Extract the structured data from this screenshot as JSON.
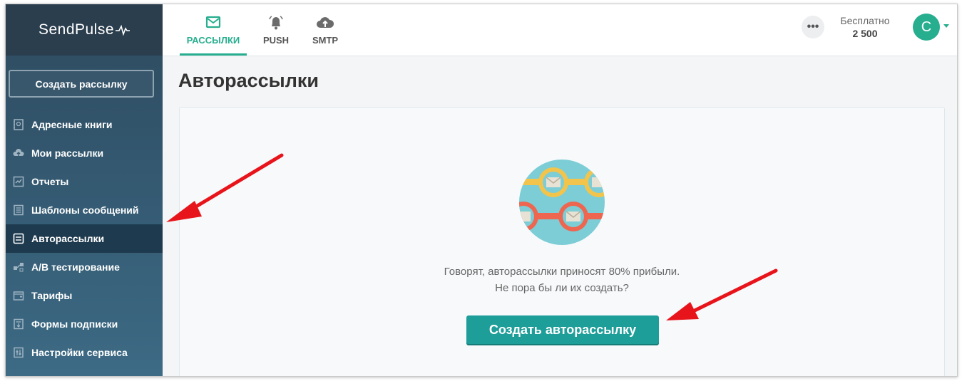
{
  "app": {
    "logo_text": "SendPulse"
  },
  "sidebar": {
    "create_button": "Создать рассылку",
    "items": [
      {
        "label": "Адресные книги",
        "icon": "address-book-icon"
      },
      {
        "label": "Мои рассылки",
        "icon": "upload-cloud-icon"
      },
      {
        "label": "Отчеты",
        "icon": "chart-icon"
      },
      {
        "label": "Шаблоны сообщений",
        "icon": "template-icon"
      },
      {
        "label": "Авторассылки",
        "icon": "autoresponder-icon",
        "active": true
      },
      {
        "label": "A/B тестирование",
        "icon": "ab-test-icon"
      },
      {
        "label": "Тарифы",
        "icon": "wallet-icon"
      },
      {
        "label": "Формы подписки",
        "icon": "form-icon"
      },
      {
        "label": "Настройки сервиса",
        "icon": "settings-sliders-icon"
      }
    ]
  },
  "topbar": {
    "tabs": [
      {
        "label": "РАССЫЛКИ",
        "icon": "envelope-icon",
        "active": true
      },
      {
        "label": "PUSH",
        "icon": "bell-icon"
      },
      {
        "label": "SMTP",
        "icon": "cloud-upload-icon"
      }
    ],
    "more_label": "•••",
    "plan_label": "Бесплатно",
    "plan_count": "2 500",
    "avatar_letter": "C"
  },
  "main": {
    "title": "Авторассылки",
    "description_line1": "Говорят, авторассылки приносят 80% прибыли.",
    "description_line2": "Не пора бы ли их создать?",
    "cta_label": "Создать авторассылку"
  },
  "colors": {
    "accent": "#27ae8f",
    "cta": "#1e9e99",
    "sidebar_dark": "#2b3e4e",
    "annotation_arrow": "#e8141b"
  }
}
